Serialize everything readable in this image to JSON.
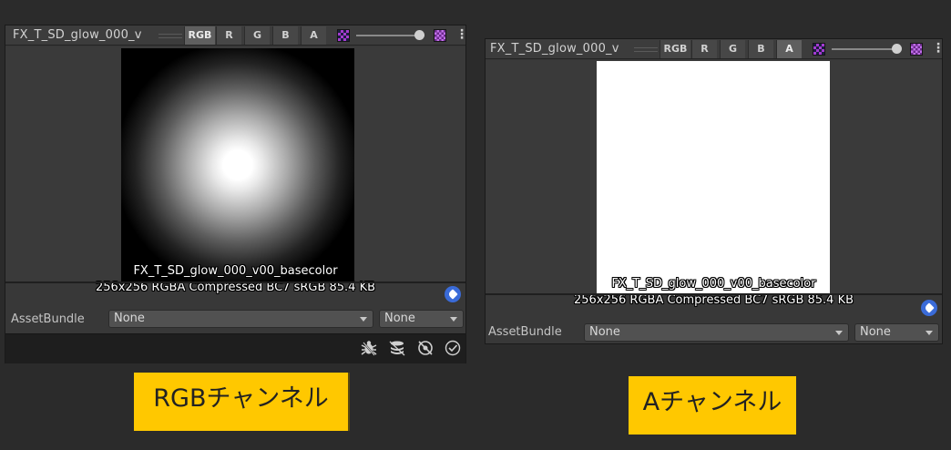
{
  "left_panel": {
    "title": "FX_T_SD_glow_000_v",
    "channels": [
      "RGB",
      "R",
      "G",
      "B",
      "A"
    ],
    "active_channel": "RGB",
    "texture_name": "FX_T_SD_glow_000_v00_basecolor",
    "texture_info": "256x256  RGBA Compressed BC7 sRGB   85.4 KB",
    "assetbundle_label": "AssetBundle",
    "assetbundle_value": "None",
    "variant_value": "None",
    "footer_icons": [
      "bug-icon",
      "layers-icon",
      "visibility-off-icon",
      "check-circle-icon"
    ]
  },
  "right_panel": {
    "title": "FX_T_SD_glow_000_v",
    "channels": [
      "RGB",
      "R",
      "G",
      "B",
      "A"
    ],
    "active_channel": "A",
    "texture_name": "FX_T_SD_glow_000_v00_basecolor",
    "texture_info": "256x256  RGBA Compressed BC7 sRGB   85.4 KB",
    "assetbundle_label": "AssetBundle",
    "assetbundle_value": "None",
    "variant_value": "None"
  },
  "captions": {
    "left": "RGBチャンネル",
    "right": "Aチャンネル"
  },
  "colors": {
    "background": "#2b2b2b",
    "panel": "#383838",
    "caption_bg": "#ffc800",
    "tag_icon": "#3a6bd8"
  }
}
